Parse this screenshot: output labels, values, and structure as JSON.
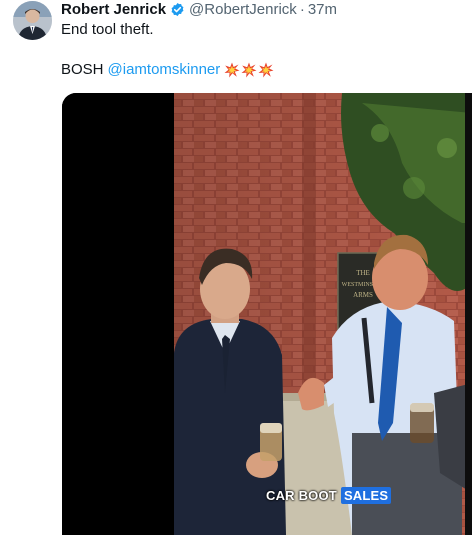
{
  "tweet": {
    "author_name": "Robert Jenrick",
    "author_handle": "@RobertJenrick",
    "separator": "·",
    "time": "37m",
    "line1": "End tool theft.",
    "line2_prefix": "BOSH",
    "mention": "@iamtomskinner",
    "emoji_name": "collision-emoji",
    "emoji_count": 3
  },
  "media": {
    "caption_white": "CAR BOOT",
    "caption_highlight": "SALES",
    "sign_line1": "THE",
    "sign_line2": "WESTMINSTER",
    "sign_line3": "ARMS"
  },
  "colors": {
    "text": "#0f1419",
    "secondary": "#536471",
    "link": "#1d9bf0",
    "verified": "#1d9bf0",
    "caption_highlight": "#1f6fe0"
  }
}
